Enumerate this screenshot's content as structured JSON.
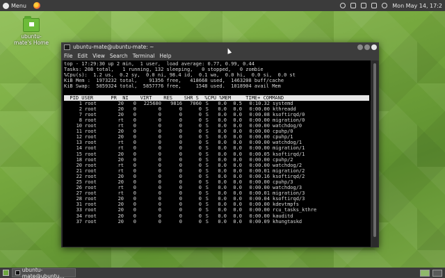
{
  "top_panel": {
    "menu_label": "Menu",
    "clock": "Mon May 14, 17:2"
  },
  "desktop": {
    "home_icon_label": "ubuntu-mate's Home"
  },
  "terminal": {
    "title": "ubuntu-mate@ubuntu-mate: ~",
    "menus": [
      "File",
      "Edit",
      "View",
      "Search",
      "Terminal",
      "Help"
    ],
    "summary": [
      "top - 17:29:30 up 2 min,  1 user,  load average: 0.77, 0.99, 0.44",
      "Tasks: 208 total,   1 running, 132 sleeping,   0 stopped,   0 zombie",
      "%Cpu(s):  1.2 us,  0.2 sy,  0.0 ni, 98.4 id,  0.1 wa,  0.0 hi,  0.0 si,  0.0 st",
      "KiB Mem :  1973232 total,    91356 free,   418668 used,  1463208 buff/cache",
      "KiB Swap:  5859324 total,  5857776 free,     1548 used.  1018904 avail Mem"
    ],
    "header": "  PID USER      PR  NI    VIRT    RES    SHR S  %CPU %MEM     TIME+ COMMAND",
    "processes": [
      [
        "1",
        "root",
        "20",
        "0",
        "225680",
        "9816",
        "7060",
        "S",
        "0.0",
        "0.5",
        "0:10.32",
        "systemd"
      ],
      [
        "2",
        "root",
        "20",
        "0",
        "0",
        "0",
        "0",
        "S",
        "0.0",
        "0.0",
        "0:00.00",
        "kthreadd"
      ],
      [
        "7",
        "root",
        "20",
        "0",
        "0",
        "0",
        "0",
        "S",
        "0.0",
        "0.0",
        "0:00.08",
        "ksoftirqd/0"
      ],
      [
        "8",
        "root",
        "rt",
        "0",
        "0",
        "0",
        "0",
        "S",
        "0.0",
        "0.0",
        "0:00.00",
        "migration/0"
      ],
      [
        "10",
        "root",
        "rt",
        "0",
        "0",
        "0",
        "0",
        "S",
        "0.0",
        "0.0",
        "0:00.00",
        "watchdog/0"
      ],
      [
        "11",
        "root",
        "20",
        "0",
        "0",
        "0",
        "0",
        "S",
        "0.0",
        "0.0",
        "0:00.00",
        "cpuhp/0"
      ],
      [
        "12",
        "root",
        "20",
        "0",
        "0",
        "0",
        "0",
        "S",
        "0.0",
        "0.0",
        "0:00.00",
        "cpuhp/1"
      ],
      [
        "13",
        "root",
        "rt",
        "0",
        "0",
        "0",
        "0",
        "S",
        "0.0",
        "0.0",
        "0:00.00",
        "watchdog/1"
      ],
      [
        "14",
        "root",
        "rt",
        "0",
        "0",
        "0",
        "0",
        "S",
        "0.0",
        "0.0",
        "0:00.00",
        "migration/1"
      ],
      [
        "15",
        "root",
        "20",
        "0",
        "0",
        "0",
        "0",
        "S",
        "0.0",
        "0.0",
        "0:00.05",
        "ksoftirqd/1"
      ],
      [
        "18",
        "root",
        "20",
        "0",
        "0",
        "0",
        "0",
        "S",
        "0.0",
        "0.0",
        "0:00.00",
        "cpuhp/2"
      ],
      [
        "20",
        "root",
        "rt",
        "0",
        "0",
        "0",
        "0",
        "S",
        "0.0",
        "0.0",
        "0:00.00",
        "watchdog/2"
      ],
      [
        "21",
        "root",
        "rt",
        "0",
        "0",
        "0",
        "0",
        "S",
        "0.0",
        "0.0",
        "0:00.01",
        "migration/2"
      ],
      [
        "22",
        "root",
        "20",
        "0",
        "0",
        "0",
        "0",
        "S",
        "0.0",
        "0.0",
        "0:00.16",
        "ksoftirqd/2"
      ],
      [
        "25",
        "root",
        "20",
        "0",
        "0",
        "0",
        "0",
        "S",
        "0.0",
        "0.0",
        "0:00.00",
        "cpuhp/3"
      ],
      [
        "26",
        "root",
        "rt",
        "0",
        "0",
        "0",
        "0",
        "S",
        "0.0",
        "0.0",
        "0:00.00",
        "watchdog/3"
      ],
      [
        "27",
        "root",
        "rt",
        "0",
        "0",
        "0",
        "0",
        "S",
        "0.0",
        "0.0",
        "0:00.01",
        "migration/3"
      ],
      [
        "28",
        "root",
        "20",
        "0",
        "0",
        "0",
        "0",
        "S",
        "0.0",
        "0.0",
        "0:00.04",
        "ksoftirqd/3"
      ],
      [
        "31",
        "root",
        "20",
        "0",
        "0",
        "0",
        "0",
        "S",
        "0.0",
        "0.0",
        "0:00.00",
        "kdevtmpfs"
      ],
      [
        "33",
        "root",
        "20",
        "0",
        "0",
        "0",
        "0",
        "S",
        "0.0",
        "0.0",
        "0:00.00",
        "rcu_tasks_kthre"
      ],
      [
        "34",
        "root",
        "20",
        "0",
        "0",
        "0",
        "0",
        "S",
        "0.0",
        "0.0",
        "0:00.00",
        "kauditd"
      ],
      [
        "37",
        "root",
        "20",
        "0",
        "0",
        "0",
        "0",
        "S",
        "0.0",
        "0.0",
        "0:00.09",
        "khungtaskd"
      ]
    ]
  },
  "bottom_panel": {
    "task_label": "ubuntu-mate@ubuntu..."
  },
  "colors": {
    "panel": "#3b3b3b",
    "terminal_bg": "#000000",
    "desktop_green": "#76a83e"
  }
}
